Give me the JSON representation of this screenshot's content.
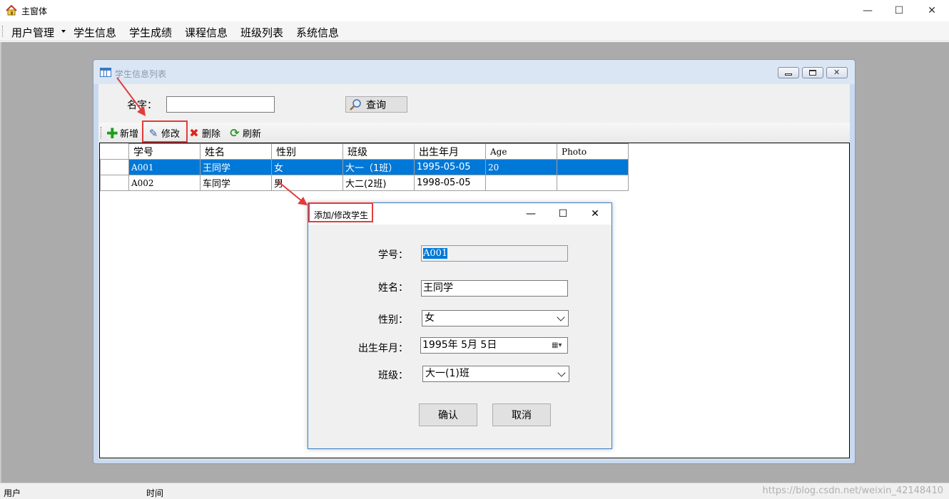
{
  "main_window": {
    "title": "主窗体",
    "controls": {
      "minimize": "—",
      "maximize": "☐",
      "close": "✕"
    }
  },
  "menubar": {
    "items": [
      "用户管理",
      "学生信息",
      "学生成绩",
      "课程信息",
      "班级列表",
      "系统信息"
    ]
  },
  "child_window": {
    "title": "学生信息列表",
    "search": {
      "label": "名字：",
      "value": "",
      "button": "查询"
    },
    "toolbar": {
      "add": "新增",
      "edit": "修改",
      "delete": "删除",
      "refresh": "刷新"
    },
    "grid": {
      "columns": [
        "学号",
        "姓名",
        "性别",
        "班级",
        "出生年月",
        "Age",
        "Photo"
      ],
      "rows": [
        {
          "selected": true,
          "id": "A001",
          "name": "王同学",
          "gender": "女",
          "class": "大一（1班）",
          "birth": "1995-05-05",
          "age": "20",
          "photo": ""
        },
        {
          "selected": false,
          "id": "A002",
          "name": "车同学",
          "gender": "男",
          "class": "大二(2班)",
          "birth": "1998-05-05",
          "age": "",
          "photo": ""
        }
      ]
    }
  },
  "dialog": {
    "title": "添加/修改学生",
    "fields": {
      "id_label": "学号：",
      "id_value": "A001",
      "name_label": "姓名：",
      "name_value": "王同学",
      "gender_label": "性别：",
      "gender_value": "女",
      "birth_label": "出生年月：",
      "birth_value": "1995年  5月  5日",
      "class_label": "班级：",
      "class_value": "大一(1)班"
    },
    "buttons": {
      "ok": "确认",
      "cancel": "取消"
    }
  },
  "statusbar": {
    "user": "用户",
    "time": "时间",
    "watermark": "https://blog.csdn.net/weixin_42148410"
  },
  "colors": {
    "selection": "#0078d7",
    "annotation": "#e33b3b",
    "mdi_background": "#ababab"
  }
}
